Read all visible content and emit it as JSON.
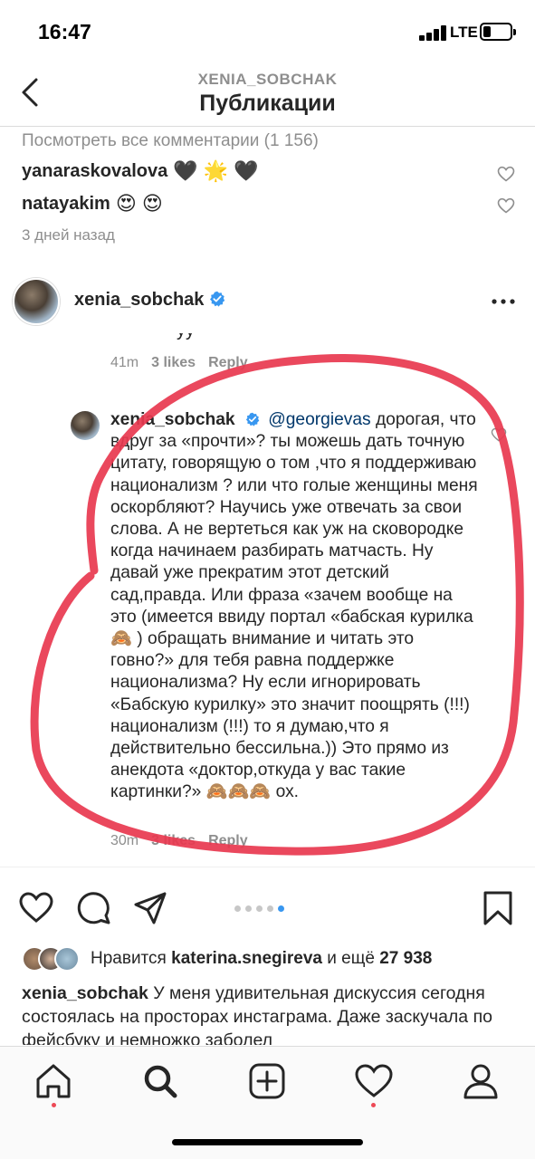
{
  "status": {
    "time": "16:47",
    "network": "LTE"
  },
  "header": {
    "username": "XENIA_SOBCHAK",
    "title": "Публикации"
  },
  "comments": {
    "view_all": "Посмотреть все комментарии (1 156)",
    "items": [
      {
        "user": "yanaraskovalova",
        "emoji": "🖤 🌟 🖤"
      },
      {
        "user": "natayakim",
        "emoji": "😍 😍"
      }
    ],
    "time_ago": "3 дней назад"
  },
  "post": {
    "username": "xenia_sobchak",
    "screenshot": {
      "cut_text": "уу",
      "meta_top": {
        "time": "41m",
        "likes": "3 likes",
        "reply": "Reply"
      },
      "reply": {
        "user": "xenia_sobchak",
        "mention": "@georgievas",
        "text": "дорогая, что вдруг за «прочти»? ты можешь дать точную цитату, говорящую о том ,что я поддерживаю национализм ? или что голые женщины меня оскорбляют? Научись уже отвечать за свои слова. А не вертеться как уж на сковородке когда начинаем разбирать матчасть. Ну давай уже прекратим этот детский сад,правда. Или фраза «зачем вообще на это (имеется ввиду портал «бабская курилка🙈 ) обращать внимание и читать это говно?» для тебя равна поддержке национализма? Ну если игнорировать «Бабскую курилку» это значит поощрять (!!!) национализм (!!!) то я думаю,что я действительно бессильна.)) Это прямо из анекдота «доктор,откуда у вас такие картинки?» 🙈🙈🙈 ох."
      },
      "meta_bottom": {
        "time": "30m",
        "likes": "3 likes",
        "reply": "Reply"
      }
    },
    "carousel": {
      "count": 5,
      "active": 4
    },
    "likes": {
      "prefix": "Нравится ",
      "user": "katerina.snegireva",
      "middle": " и ещё ",
      "count": "27 938"
    },
    "caption": {
      "user": "xenia_sobchak",
      "text": " У меня удивительная дискуссия сегодня состоялась на просторах инстаграма. Даже заскучала по фейсбуку и немножко заболел"
    }
  },
  "colors": {
    "accent": "#3897f0",
    "annotation": "#e8384f",
    "notification": "#ed4956"
  },
  "icons": [
    "back-icon",
    "heart-icon",
    "verified-icon",
    "more-icon",
    "comment-icon",
    "share-icon",
    "bookmark-icon",
    "home-icon",
    "search-icon",
    "add-icon",
    "activity-icon",
    "profile-icon"
  ]
}
